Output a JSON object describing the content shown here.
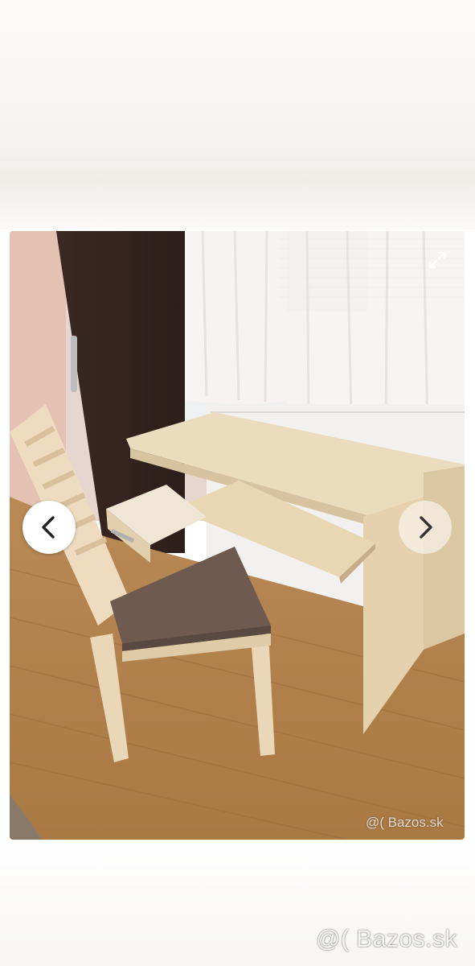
{
  "gallery": {
    "photo_alt": "Desk with pull-out keyboard shelf and wooden chair",
    "watermark_inner": "@( Bazos.sk",
    "watermark_outer": "@( Bazos.sk",
    "prev_icon": "chevron-left-icon",
    "next_icon": "chevron-right-icon",
    "expand_icon": "expand-icon"
  }
}
